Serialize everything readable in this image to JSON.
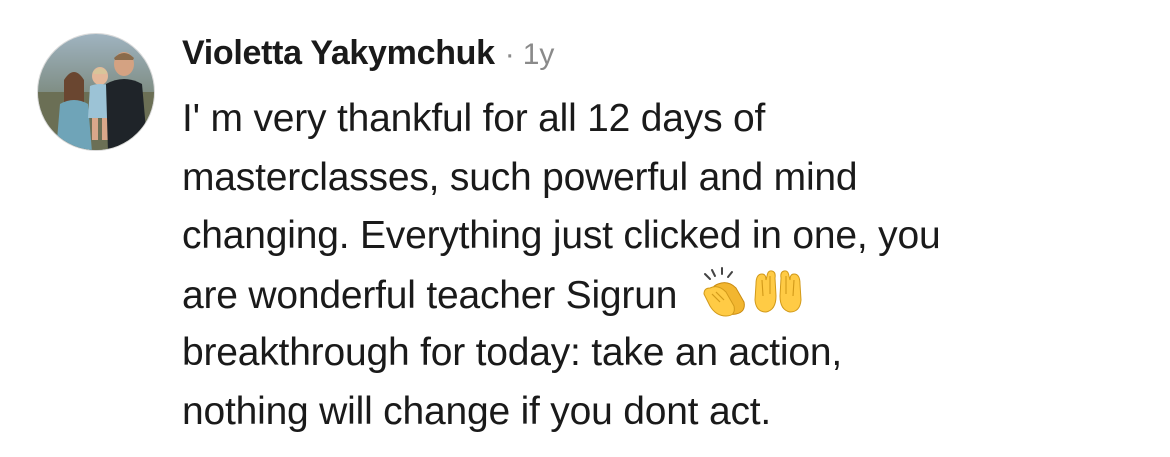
{
  "comment": {
    "author": "Violetta Yakymchuk",
    "separator": "·",
    "time": "1y",
    "text_lines": [
      "I' m very thankful for all 12 days of",
      "masterclasses, such powerful and mind",
      "changing. Everything just clicked in one, you",
      "are wonderful teacher Sigrun",
      "breakthrough for today: take an action,",
      "nothing will change if you dont act."
    ],
    "emojis": [
      "clapping-hands-emoji",
      "palms-up-together-emoji"
    ]
  }
}
